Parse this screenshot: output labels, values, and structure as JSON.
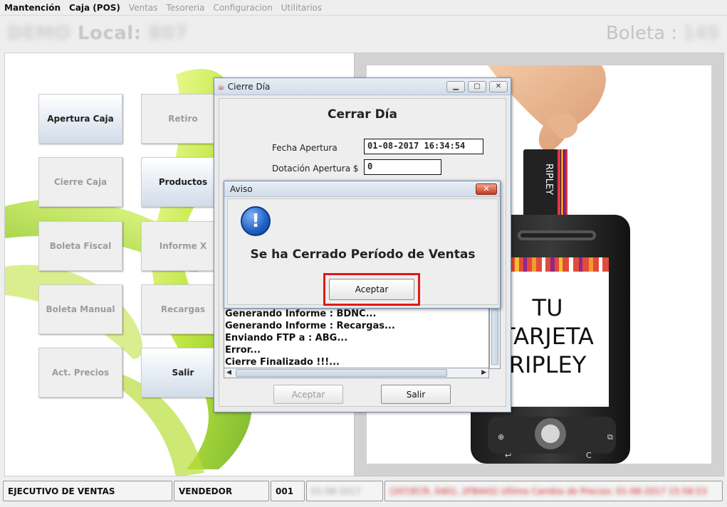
{
  "menubar": {
    "items": [
      {
        "label": "Mantención",
        "enabled": true
      },
      {
        "label": "Caja (POS)",
        "enabled": true
      },
      {
        "label": "Ventas",
        "enabled": false
      },
      {
        "label": "Tesoreria",
        "enabled": false
      },
      {
        "label": "Configuracion",
        "enabled": false
      },
      {
        "label": "Utilitarios",
        "enabled": false
      }
    ]
  },
  "header": {
    "local_prefix": "DEMO",
    "local_label": "Local:",
    "local_number": "807",
    "boleta_label": "Boleta :",
    "boleta_number": "149"
  },
  "menu_buttons": [
    {
      "label": "Apertura Caja",
      "enabled": true
    },
    {
      "label": "Retiro",
      "enabled": false
    },
    {
      "label": "Cierre Caja",
      "enabled": false
    },
    {
      "label": "Productos",
      "enabled": true
    },
    {
      "label": "Boleta Fiscal",
      "enabled": false
    },
    {
      "label": "Informe X",
      "enabled": false
    },
    {
      "label": "Boleta Manual",
      "enabled": false
    },
    {
      "label": "Recargas",
      "enabled": false
    },
    {
      "label": "Act. Precios",
      "enabled": false
    },
    {
      "label": "Salir",
      "enabled": true
    }
  ],
  "ad": {
    "line1": "TU",
    "line2": "TARJETA",
    "line3": "RIPLEY",
    "card_brand": "RIPLEY"
  },
  "cierre_dialog": {
    "window_title": "Cierre Día",
    "heading": "Cerrar Día",
    "fecha_label": "Fecha Apertura",
    "fecha_value": "01-08-2017 16:34:54",
    "dotacion_label": "Dotación Apertura $",
    "dotacion_value": "0",
    "log_lines": [
      "Generando Informe : BDNC...",
      "Generando Informe : Recargas...",
      "Enviando FTP a : ABG...",
      "Error...",
      "Cierre Finalizado !!!..."
    ],
    "aceptar_label": "Aceptar",
    "salir_label": "Salir"
  },
  "aviso_dialog": {
    "title": "Aviso",
    "message": "Se ha Cerrado Período de Ventas",
    "button_label": "Aceptar"
  },
  "statusbar": {
    "role": "EJECUTIVO DE VENTAS",
    "user_type": "VENDEDOR",
    "code": "001",
    "date": "01-08-2017",
    "message": "(207/ECR, 0401, 2FB4A5) Ultimo Cambio de Precios: 01-08-2017 15:58:53"
  },
  "colors": {
    "accent_blue": "#1f5fc4",
    "alert_red": "#e01818",
    "status_message_red": "#d02020"
  }
}
